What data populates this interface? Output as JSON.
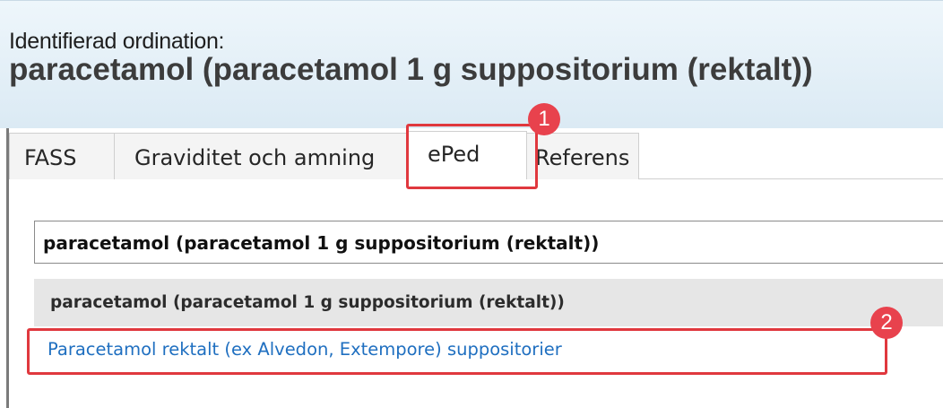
{
  "header": {
    "caption": "Identifierad ordination:",
    "title": "paracetamol (paracetamol 1 g suppositorium (rektalt))"
  },
  "tabs": [
    {
      "label": "FASS",
      "active": false
    },
    {
      "label": "Graviditet och amning",
      "active": false
    },
    {
      "label": "ePed",
      "active": true
    },
    {
      "label": "Referens",
      "active": false
    }
  ],
  "search": {
    "value": "paracetamol (paracetamol 1 g suppositorium (rektalt))"
  },
  "results": {
    "group_header": "paracetamol (paracetamol 1 g suppositorium (rektalt))",
    "items": [
      {
        "label": "Paracetamol rektalt (ex Alvedon, Extempore) suppositorier"
      }
    ]
  },
  "callouts": [
    {
      "number": "1"
    },
    {
      "number": "2"
    }
  ],
  "colors": {
    "callout_red": "#e0383e",
    "link_blue": "#1f6fc0",
    "header_bg": "#dbeaf4"
  }
}
